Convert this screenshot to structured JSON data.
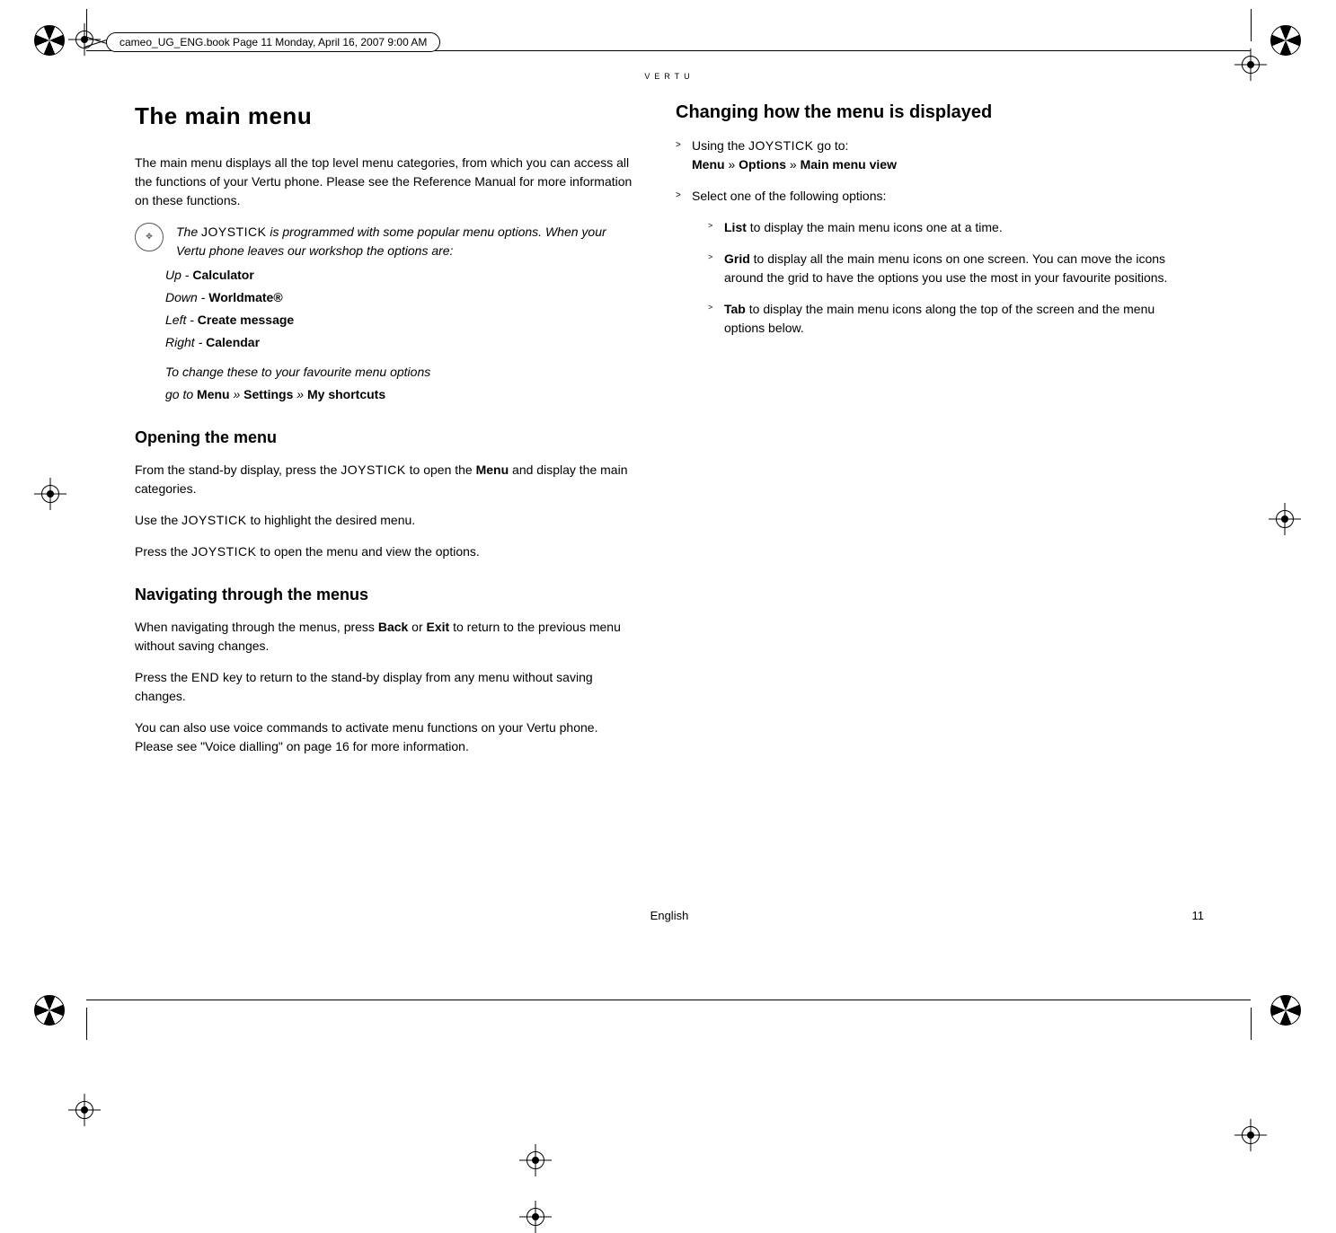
{
  "file_tag": "cameo_UG_ENG.book  Page 11  Monday, April 16, 2007  9:00 AM",
  "brand": "VERTU",
  "left": {
    "h1": "The main menu",
    "intro": "The main menu displays all the top level menu categories, from which you can access all the functions of your Vertu phone. Please see the Reference Manual for more information on these functions.",
    "note_a": "The ",
    "note_joystick": "JOYSTICK",
    "note_b": " is programmed with some popular menu options. When your Vertu phone leaves our workshop the options are:",
    "up_lbl": "Up - ",
    "up_val": "Calculator",
    "down_lbl": "Down - ",
    "down_val": "Worldmate®",
    "left_lbl": "Left - ",
    "left_val": "Create message",
    "right_lbl": "Right - ",
    "right_val": "Calendar",
    "change_a": "To change these to your favourite menu options",
    "change_b_pre": "go to ",
    "change_b_menu": "Menu",
    "sep1": " » ",
    "change_b_settings": "Settings",
    "sep2": " » ",
    "change_b_short": "My shortcuts",
    "h2_open": "Opening the menu",
    "open_p1_a": "From the stand-by display, press the ",
    "open_p1_b": " to open the ",
    "open_p1_menu": "Menu",
    "open_p1_c": " and display the main categories.",
    "open_p2_a": "Use the ",
    "open_p2_b": " to highlight the desired menu.",
    "open_p3_a": "Press the ",
    "open_p3_b": " to open the menu and view the options.",
    "h2_nav": "Navigating through the menus",
    "nav_p1_a": "When navigating through the menus, press ",
    "nav_back": "Back",
    "nav_or": " or ",
    "nav_exit": "Exit",
    "nav_p1_b": " to return to the previous menu without saving changes.",
    "nav_p2_a": "Press the ",
    "nav_end": "END",
    "nav_p2_b": " key to return to the stand-by display from any menu without saving changes.",
    "nav_p3": "You can also use voice commands to activate menu functions on your Vertu phone. Please see \"Voice dialling\" on page 16 for more information."
  },
  "right": {
    "h2": "Changing how the menu is displayed",
    "b1_a": "Using the ",
    "b1_b": " go to:",
    "b1_menu": "Menu",
    "sep1": " » ",
    "b1_opt": "Options",
    "sep2": " » ",
    "b1_view": "Main menu view",
    "b2": "Select one of the following options:",
    "s1_b": "List",
    "s1_t": " to display the main menu icons one at a time.",
    "s2_b": "Grid",
    "s2_t": " to display all the main menu icons on one screen. You can move the icons around the grid to have the options you use the most in your favourite positions.",
    "s3_b": "Tab",
    "s3_t": " to display the main menu icons along the top of the screen and the menu options below."
  },
  "joystick": "JOYSTICK",
  "footer_lang": "English",
  "footer_page": "11"
}
